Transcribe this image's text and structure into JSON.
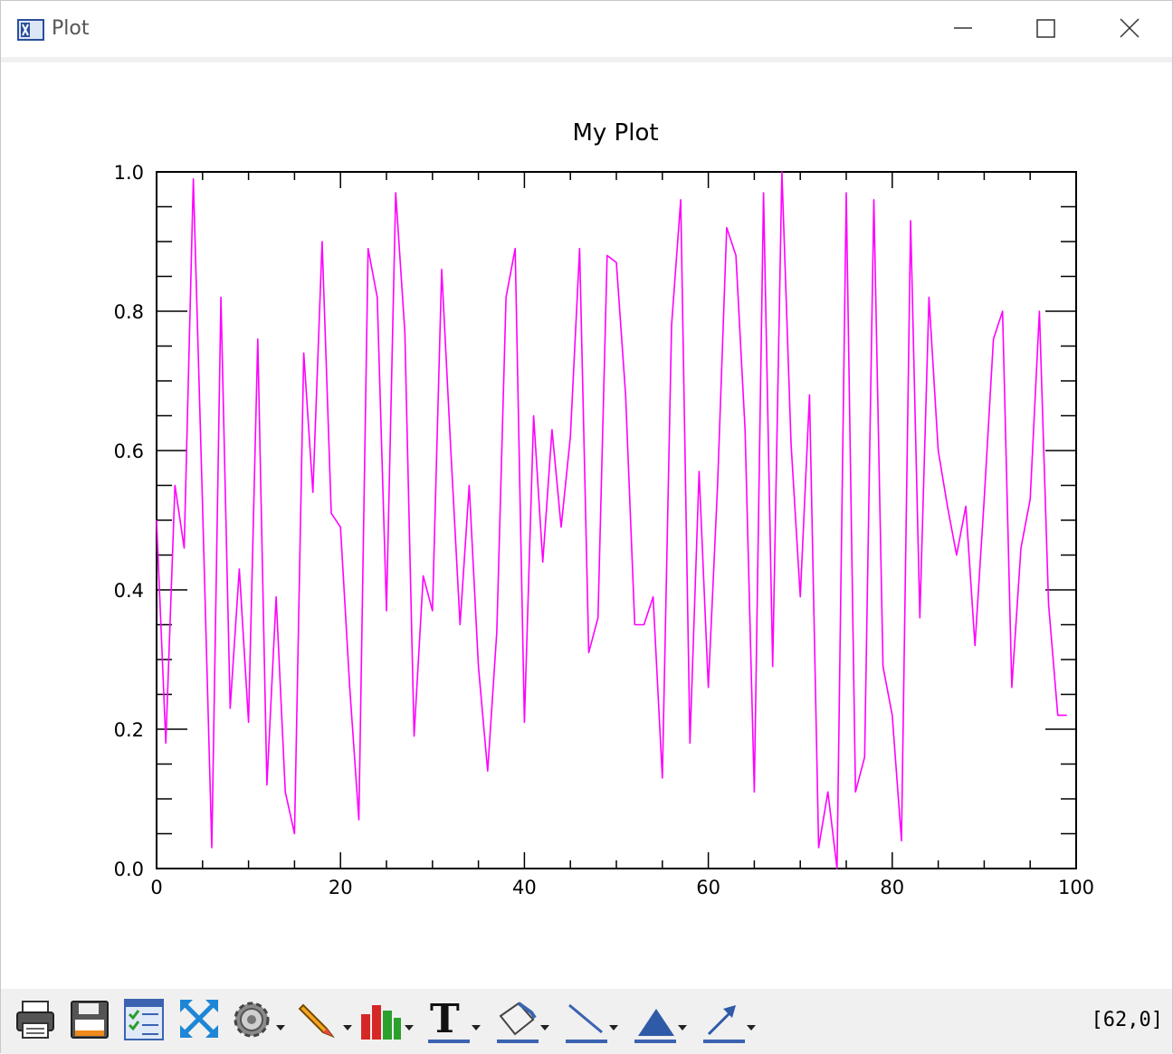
{
  "window": {
    "title": "Plot",
    "controls": {
      "minimize": "minimize-icon",
      "maximize": "maximize-icon",
      "close": "close-icon"
    }
  },
  "chart_data": {
    "type": "line",
    "title": "My Plot",
    "xlabel": "",
    "ylabel": "",
    "xlim": [
      0,
      100
    ],
    "ylim": [
      0.0,
      1.0
    ],
    "xticks": [
      "0",
      "20",
      "40",
      "60",
      "80",
      "100"
    ],
    "yticks": [
      "0.0",
      "0.2",
      "0.4",
      "0.6",
      "0.8",
      "1.0"
    ],
    "grid": false,
    "line_color": "#ff00ff",
    "series": [
      {
        "x": [
          0,
          1,
          2,
          3,
          4,
          5,
          6,
          7,
          8,
          9,
          10,
          11,
          12,
          13,
          14,
          15,
          16,
          17,
          18,
          19,
          20,
          21,
          22,
          23,
          24,
          25,
          26,
          27,
          28,
          29,
          30,
          31,
          32,
          33,
          34,
          35,
          36,
          37,
          38,
          39,
          40,
          41,
          42,
          43,
          44,
          45,
          46,
          47,
          48,
          49,
          50,
          51,
          52,
          53,
          54,
          55,
          56,
          57,
          58,
          59,
          60,
          61,
          62,
          63,
          64,
          65,
          66,
          67,
          68,
          69,
          70,
          71,
          72,
          73,
          74,
          75,
          76,
          77,
          78,
          79,
          80,
          81,
          82,
          83,
          84,
          85,
          86,
          87,
          88,
          89,
          90,
          91,
          92,
          93,
          94,
          95,
          96,
          97,
          98,
          99
        ],
        "values": [
          0.5,
          0.18,
          0.55,
          0.46,
          0.99,
          0.52,
          0.03,
          0.82,
          0.23,
          0.43,
          0.21,
          0.76,
          0.12,
          0.39,
          0.11,
          0.05,
          0.74,
          0.54,
          0.9,
          0.51,
          0.49,
          0.26,
          0.07,
          0.89,
          0.82,
          0.37,
          0.97,
          0.77,
          0.19,
          0.42,
          0.37,
          0.86,
          0.6,
          0.35,
          0.55,
          0.29,
          0.14,
          0.34,
          0.82,
          0.89,
          0.21,
          0.65,
          0.44,
          0.63,
          0.49,
          0.62,
          0.89,
          0.31,
          0.36,
          0.88,
          0.87,
          0.68,
          0.35,
          0.35,
          0.39,
          0.13,
          0.78,
          0.96,
          0.18,
          0.57,
          0.26,
          0.55,
          0.92,
          0.88,
          0.63,
          0.11,
          0.97,
          0.29,
          1.0,
          0.61,
          0.39,
          0.68,
          0.03,
          0.11,
          0.0,
          0.97,
          0.11,
          0.16,
          0.96,
          0.29,
          0.22,
          0.04,
          0.93,
          0.36,
          0.82,
          0.6,
          0.52,
          0.45,
          0.52,
          0.32,
          0.53,
          0.76,
          0.8,
          0.26,
          0.46,
          0.53,
          0.8,
          0.38,
          0.22,
          0.22
        ]
      }
    ]
  },
  "toolbar": {
    "items": [
      "printer-icon",
      "save-icon",
      "checklist-icon",
      "fit-axes-icon",
      "settings-gear-icon",
      "pencil-icon",
      "bar-chart-icon",
      "text-icon",
      "paint-bucket-icon",
      "line-tool-icon",
      "triangle-fill-icon",
      "arrow-tool-icon"
    ]
  },
  "status": {
    "coords": "[62,0]"
  }
}
